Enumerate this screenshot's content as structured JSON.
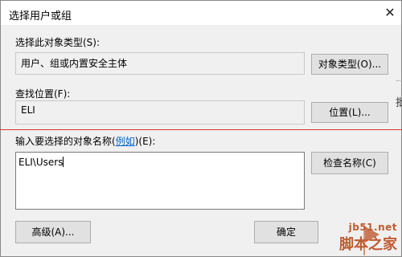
{
  "window": {
    "title": "选择用户或组",
    "close_glyph": "✕"
  },
  "object_type": {
    "label": "选择此对象类型(S):",
    "value": "用户、组或内置安全主体",
    "button_label": "对象类型(O)..."
  },
  "location": {
    "label": "查找位置(F):",
    "value": "ELI",
    "button_label": "位置(L)..."
  },
  "names": {
    "label_prefix": "输入要选择的对象名称(",
    "label_link": "例如",
    "label_suffix": ")(E):",
    "value": "ELI\\Users",
    "check_button_label": "检查名称(C)"
  },
  "footer": {
    "advanced_button_label": "高级(A)...",
    "ok_button_label": "确定"
  },
  "background": {
    "peek_text": "批"
  },
  "watermark": {
    "url": "jb51.net",
    "name": "脚本之家"
  }
}
